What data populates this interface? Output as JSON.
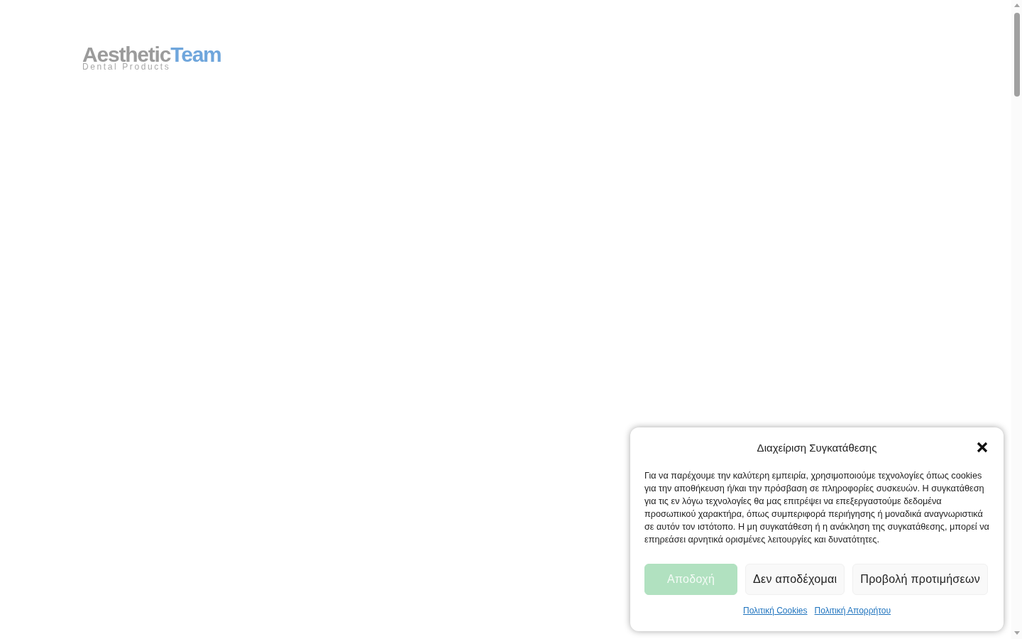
{
  "logo": {
    "name_first": "Aesthetic",
    "name_second": "Team",
    "tagline": "Dental Products"
  },
  "consent_dialog": {
    "title": "Διαχείριση Συγκατάθεσης",
    "message": "Για να παρέχουμε την καλύτερη εμπειρία, χρησιμοποιούμε τεχνολογίες όπως cookies για την αποθήκευση ή/και την πρόσβαση σε πληροφορίες συσκευών. Η συγκατάθεση για τις εν λόγω τεχνολογίες θα μας επιτρέψει να επεξεργαστούμε δεδομένα προσωπικού χαρακτήρα, όπως συμπεριφορά περιήγησης ή μοναδικά αναγνωριστικά σε αυτόν τον ιστότοπο. Η μη συγκατάθεση ή η ανάκληση της συγκατάθεσης, μπορεί να επηρεάσει αρνητικά ορισμένες λειτουργίες και δυνατότητες.",
    "buttons": [
      {
        "label": "Αποδοχή",
        "kind": "primary"
      },
      {
        "label": "Δεν αποδέχομαι",
        "kind": "secondary"
      },
      {
        "label": "Προβολή προτιμήσεων",
        "kind": "secondary"
      }
    ],
    "links": [
      "Πολιτική Cookies",
      "Πολιτική Απορρήτου"
    ]
  }
}
